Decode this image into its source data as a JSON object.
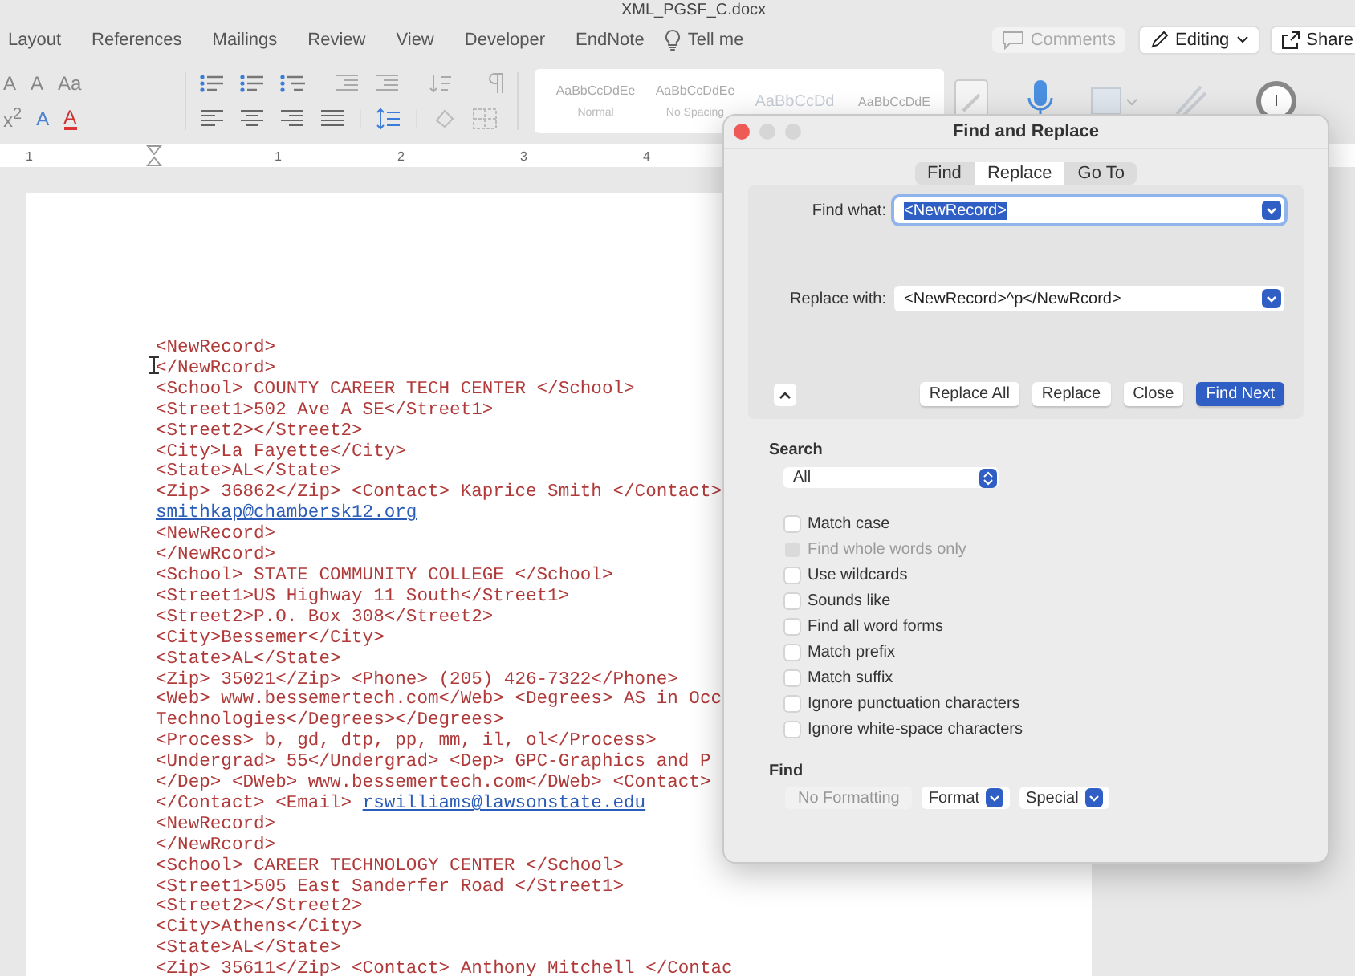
{
  "app_title": "XML_PGSF_C.docx",
  "menu": [
    {
      "label": "Layout"
    },
    {
      "label": "References"
    },
    {
      "label": "Mailings"
    },
    {
      "label": "Review"
    },
    {
      "label": "View"
    },
    {
      "label": "Developer"
    },
    {
      "label": "EndNote"
    }
  ],
  "tell_me": "Tell me",
  "comments": "Comments",
  "editing": "Editing",
  "share": "Share",
  "ribbon": {
    "font_tools": [
      "A",
      "A",
      "Aa"
    ],
    "format_tools": [
      "x$^{2}$",
      "A",
      "A"
    ],
    "styles": [
      {
        "sample": "AaBbCcDdEe",
        "name": "Normal"
      },
      {
        "sample": "AaBbCcDdEe",
        "name": "No Spacing"
      },
      {
        "sample": "AaBbCcDd"
      },
      {
        "sample": "AaBbCcDdE"
      }
    ]
  },
  "ruler": [
    "1",
    "1",
    "2",
    "3",
    "4"
  ],
  "document": {
    "lines": [
      {
        "text": "<NewRecord>"
      },
      {
        "text": "</NewRcord>"
      },
      {
        "text": "<School> COUNTY CAREER TECH CENTER </School>"
      },
      {
        "text": "<Street1>502 Ave A SE</Street1>"
      },
      {
        "text": "<Street2></Street2>"
      },
      {
        "text": "<City>La Fayette</City>"
      },
      {
        "text": "<State>AL</State>"
      },
      {
        "text": "<Zip> 36862</Zip> <Contact> Kaprice Smith </Contact>"
      },
      {
        "link": "smithkap@chambersk12.org"
      },
      {
        "text": "<NewRecord>"
      },
      {
        "text": "</NewRcord>"
      },
      {
        "text": "<School> STATE COMMUNITY COLLEGE </School>"
      },
      {
        "text": "<Street1>US Highway 11 South</Street1>"
      },
      {
        "text": "<Street2>P.O. Box 308</Street2>"
      },
      {
        "text": "<City>Bessemer</City>"
      },
      {
        "text": "<State>AL</State>"
      },
      {
        "text": "<Zip> 35021</Zip> <Phone> (205) 426-7322</Phone>"
      },
      {
        "text": "<Web> www.bessemertech.com</Web> <Degrees> AS in Occ"
      },
      {
        "text": "Technologies</Degrees></Degrees>"
      },
      {
        "text": "<Process> b, gd, dtp, pp, mm, il, ol</Process>"
      },
      {
        "text": "<Undergrad> 55</Undergrad> <Dep> GPC-Graphics and P"
      },
      {
        "text": "</Dep> <DWeb> www.bessemertech.com</DWeb> <Contact>"
      },
      {
        "text": "</Contact> <Email> ",
        "link": "rswilliams@lawsonstate.edu"
      },
      {
        "text": "<NewRecord>"
      },
      {
        "text": "</NewRcord>"
      },
      {
        "text": "<School> CAREER TECHNOLOGY CENTER </School>"
      },
      {
        "text": "<Street1>505 East Sanderfer Road </Street1>"
      },
      {
        "text": "<Street2></Street2>"
      },
      {
        "text": "<City>Athens</City>"
      },
      {
        "text": "<State>AL</State>"
      },
      {
        "text": "<Zip> 35611</Zip> <Contact> Anthony Mitchell </Contac"
      }
    ]
  },
  "dialog": {
    "title": "Find and Replace",
    "tabs": [
      {
        "label": "Find",
        "selected": false
      },
      {
        "label": "Replace",
        "selected": true
      },
      {
        "label": "Go To",
        "selected": false
      }
    ],
    "find_label": "Find what:",
    "find_value": "<NewRecord>",
    "find_value_selected": true,
    "replace_label": "Replace with:",
    "replace_value": "<NewRecord>^p</NewRcord>",
    "buttons": [
      {
        "label": "Replace All",
        "default": false
      },
      {
        "label": "Replace",
        "default": false
      },
      {
        "label": "Close",
        "default": false
      },
      {
        "label": "Find Next",
        "default": true
      }
    ],
    "search_heading": "Search",
    "search_scope": "All",
    "options": [
      {
        "label": "Match case",
        "checked": false,
        "disabled": false
      },
      {
        "label": "Find whole words only",
        "checked": false,
        "disabled": true
      },
      {
        "label": "Use wildcards",
        "checked": false,
        "disabled": false
      },
      {
        "label": "Sounds like",
        "checked": false,
        "disabled": false
      },
      {
        "label": "Find all word forms",
        "checked": false,
        "disabled": false
      },
      {
        "label": "Match prefix",
        "checked": false,
        "disabled": false
      },
      {
        "label": "Match suffix",
        "checked": false,
        "disabled": false
      },
      {
        "label": "Ignore punctuation characters",
        "checked": false,
        "disabled": false
      },
      {
        "label": "Ignore white-space characters",
        "checked": false,
        "disabled": false
      }
    ],
    "find_heading": "Find",
    "find_tools": [
      {
        "label": "No Formatting",
        "kind": "button",
        "disabled": true
      },
      {
        "label": "Format",
        "kind": "menu",
        "disabled": false
      },
      {
        "label": "Special",
        "kind": "menu",
        "disabled": false
      }
    ]
  }
}
